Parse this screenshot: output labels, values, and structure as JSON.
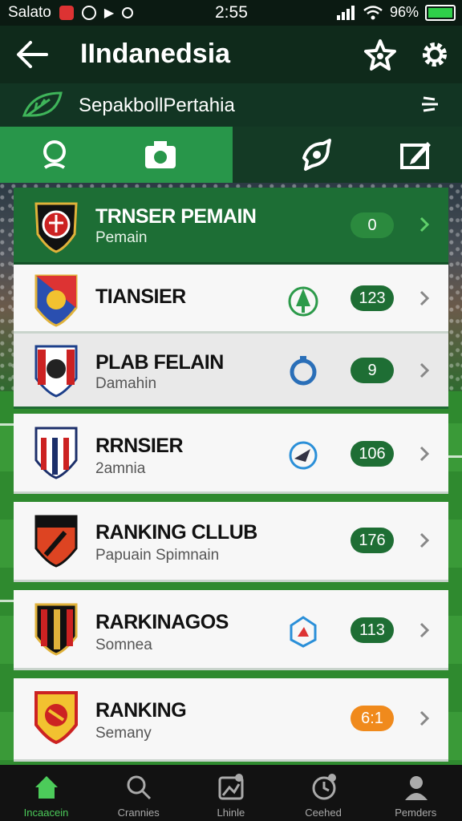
{
  "status_bar": {
    "carrier": "Salato",
    "time": "2:55",
    "battery": "96%"
  },
  "app_bar": {
    "title": "IIndanedsia",
    "back_icon": "back-arrow-icon",
    "favorite_icon": "star-icon",
    "settings_icon": "gear-icon"
  },
  "sub_header": {
    "title": "SepakbollPertahia",
    "icon": "leaf-icon",
    "sort_icon": "sort-icon"
  },
  "tabs": [
    {
      "icon": "search-icon",
      "active": true
    },
    {
      "icon": "camera-icon",
      "active": true
    },
    {
      "icon": "explore-icon",
      "active": false
    },
    {
      "icon": "edit-icon",
      "active": false
    }
  ],
  "list": [
    {
      "title": "TRNSER PEMAIN",
      "subtitle": "Pemain",
      "badge": "0",
      "badge_color": "#1e6e34",
      "trend_icon": "",
      "style": "header"
    },
    {
      "title": "TIANSIER",
      "subtitle": "",
      "badge": "123",
      "badge_color": "#1e6e34",
      "trend_icon": "tree-icon",
      "style": "normal"
    },
    {
      "title": "PLAB FELAIN",
      "subtitle": "Damahin",
      "badge": "9",
      "badge_color": "#1e6e34",
      "trend_icon": "refresh-icon",
      "style": "alt"
    },
    {
      "title": "RRNSIER",
      "subtitle": "2amnia",
      "badge": "106",
      "badge_color": "#1e6e34",
      "trend_icon": "shield-icon",
      "style": "normal"
    },
    {
      "title": "RANKING CLLUB",
      "subtitle": "Papuain Spimnain",
      "badge": "176",
      "badge_color": "#1e6e34",
      "trend_icon": "",
      "style": "normal"
    },
    {
      "title": "RARKINAGOS",
      "subtitle": "Somnea",
      "badge": "113",
      "badge_color": "#1e6e34",
      "trend_icon": "flask-icon",
      "style": "normal"
    },
    {
      "title": "RANKING",
      "subtitle": "Semany",
      "badge": "6:1",
      "badge_color": "#f08a1c",
      "trend_icon": "",
      "style": "normal"
    }
  ],
  "bottom_nav": [
    {
      "label": "Incaacein",
      "icon": "home-icon",
      "active": true
    },
    {
      "label": "Crannies",
      "icon": "search-icon",
      "active": false
    },
    {
      "label": "Lhinle",
      "icon": "image-icon",
      "active": false
    },
    {
      "label": "Ceehed",
      "icon": "clock-icon",
      "active": false
    },
    {
      "label": "Pemders",
      "icon": "person-icon",
      "active": false
    }
  ],
  "colors": {
    "primary": "#1d6e35",
    "accent": "#28964a",
    "badge_green": "#1e6e34",
    "badge_orange": "#f08a1c"
  }
}
